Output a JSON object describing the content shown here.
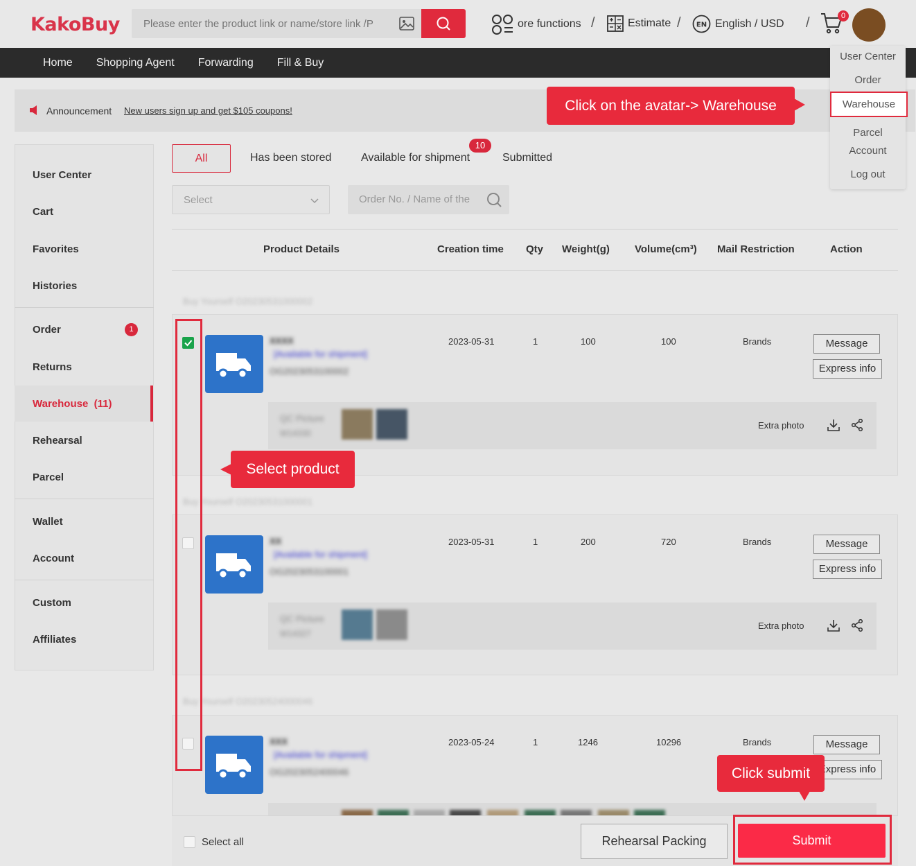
{
  "header": {
    "logo": "KakoBuy",
    "search_placeholder": "Please enter the product link or name/store link /P",
    "more_functions": "ore functions",
    "estimate": "Estimate",
    "lang_badge": "EN",
    "language": "English / USD",
    "cart_count": "0",
    "slash": "/"
  },
  "nav": [
    "Home",
    "Shopping Agent",
    "Forwarding",
    "Fill & Buy"
  ],
  "announcement": {
    "label": "Announcement",
    "link": "New users sign up and get $105 coupons!"
  },
  "dropdown": [
    "User Center",
    "Order",
    "Warehouse",
    "Parcel",
    "Account",
    "Log out"
  ],
  "callouts": {
    "avatar": "Click on the avatar-> Warehouse",
    "select": "Select product",
    "submit": "Click submit"
  },
  "sidebar": {
    "items": [
      "User Center",
      "Cart",
      "Favorites",
      "Histories",
      "Order",
      "Returns",
      "Warehouse  (11)",
      "Rehearsal",
      "Parcel",
      "Wallet",
      "Account",
      "Custom",
      "Affiliates"
    ],
    "order_badge": "1"
  },
  "tabs": {
    "all": "All",
    "stored": "Has been stored",
    "available": "Available for shipment",
    "available_badge": "10",
    "submitted": "Submitted"
  },
  "filters": {
    "select_placeholder": "Select",
    "search_placeholder": "Order No. / Name of the"
  },
  "table_headers": [
    "Product Details",
    "Creation time",
    "Qty",
    "Weight(g)",
    "Volume(cm³)",
    "Mail Restriction",
    "Action"
  ],
  "rows": [
    {
      "group": "Buy Yourself  O20230531000002",
      "date": "2023-05-31",
      "qty": "1",
      "weight": "100",
      "volume": "100",
      "restriction": "Brands",
      "checked": true,
      "title": "XXXX",
      "status": "[Available for shipment]",
      "code": "OG2023053100002",
      "qc": "QC Picture",
      "qc_id": "W14330"
    },
    {
      "group": "Buy Yourself  O20230531000001",
      "date": "2023-05-31",
      "qty": "1",
      "weight": "200",
      "volume": "720",
      "restriction": "Brands",
      "checked": false,
      "title": "XX",
      "status": "[Available for shipment]",
      "code": "OG2023053100001",
      "qc": "QC Picture",
      "qc_id": "W14327"
    },
    {
      "group": "Buy Yourself  O20230524000046",
      "date": "2023-05-24",
      "qty": "1",
      "weight": "1246",
      "volume": "10296",
      "restriction": "Brands",
      "checked": false,
      "title": "XXX",
      "status": "[Available for shipment]",
      "code": "OG2023052400046",
      "qc": "",
      "qc_id": ""
    }
  ],
  "row_actions": {
    "message": "Message",
    "express": "Express info",
    "extra_photo": "Extra photo"
  },
  "footer": {
    "select_all": "Select all",
    "rehearsal": "Rehearsal Packing",
    "submit": "Submit"
  },
  "colors": {
    "accent": "#e02a3d",
    "thumb_blue": "#2d73c9",
    "nav_bg": "#2b2b2b",
    "avatar": "#7a4d22"
  }
}
